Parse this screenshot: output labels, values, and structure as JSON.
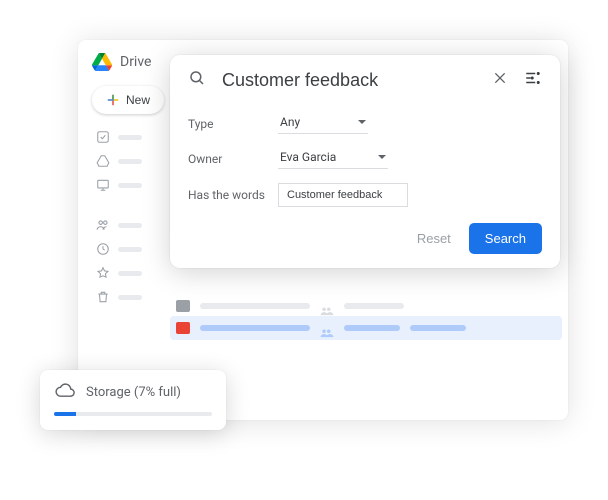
{
  "app": {
    "title": "Drive"
  },
  "sidebar": {
    "new_label": "New"
  },
  "search": {
    "query": "Customer feedback",
    "filters": {
      "type_label": "Type",
      "type_value": "Any",
      "owner_label": "Owner",
      "owner_value": "Eva Garcia",
      "words_label": "Has the words",
      "words_value": "Customer feedback"
    },
    "reset_label": "Reset",
    "search_label": "Search"
  },
  "storage": {
    "label": "Storage (7% full)",
    "percent": 7
  },
  "colors": {
    "primary": "#1a73e8",
    "text_muted": "#5f6368"
  }
}
